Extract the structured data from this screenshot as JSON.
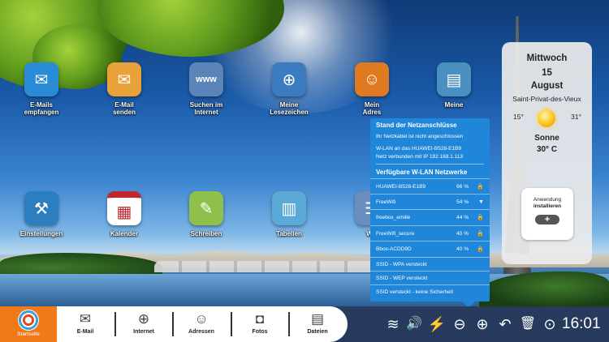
{
  "desktop": {
    "apps": [
      {
        "id": "emails-empfangen",
        "line1": "E-Mails",
        "line2": "empfangen",
        "color": "#2a8bd6",
        "glyph": "✉"
      },
      {
        "id": "email-senden",
        "line1": "E-Mail",
        "line2": "senden",
        "color": "#3aa0e0",
        "glyph": "✉"
      },
      {
        "id": "suchen",
        "line1": "Suchen im",
        "line2": "Internet",
        "color": "#5b84b8",
        "glyph": "www"
      },
      {
        "id": "lesezeichen",
        "line1": "Meine",
        "line2": "Lesezeichen",
        "color": "#3b7bc0",
        "glyph": "⊕"
      },
      {
        "id": "adressen",
        "line1": "Mein",
        "line2": "Adres",
        "color": "#e07a20",
        "glyph": "☺"
      },
      {
        "id": "bilder",
        "line1": "Meine",
        "line2": "",
        "color": "#4a90c0",
        "glyph": "▤"
      },
      {
        "id": "einstellungen",
        "line1": "Einstellungen",
        "line2": "",
        "color": "#2b7fbf",
        "glyph": "⚒"
      },
      {
        "id": "kalender",
        "line1": "Kalender",
        "line2": "",
        "color": "#d8d8d8",
        "glyph": "▦"
      },
      {
        "id": "schreiben",
        "line1": "Schreiben",
        "line2": "",
        "color": "#8fc04a",
        "glyph": "✎"
      },
      {
        "id": "tabellen",
        "line1": "Tabellen",
        "line2": "",
        "color": "#5aa9d6",
        "glyph": "▥"
      },
      {
        "id": "web",
        "line1": "We",
        "line2": "",
        "color": "#6a8fbf",
        "glyph": "☷"
      }
    ]
  },
  "network": {
    "status_title": "Stand der Netzanschlüsse",
    "cable_status": "Ihr Netzkabel ist nicht angeschlossen",
    "wifi_line1": "W-LAN an das HUAWEI-B528-E1B9",
    "wifi_line2": "Netz verbunden mit IP 192.168.1.113",
    "available_title": "Verfügbare W-LAN Netzwerke",
    "networks": [
      {
        "name": "HUAWEI-B528-E1B9",
        "percent": "66 %",
        "icon": "🔒"
      },
      {
        "name": "FreeWifi",
        "percent": "54 %",
        "icon": "▼"
      },
      {
        "name": "freebox_emilie",
        "percent": "44 %",
        "icon": "🔒"
      },
      {
        "name": "FreeWifi_secure",
        "percent": "40 %",
        "icon": "🔒"
      },
      {
        "name": "Bbox-ACDD9D",
        "percent": "40 %",
        "icon": "🔒"
      }
    ],
    "hidden": [
      "SSID - WPA versteckt",
      "SSID - WEP versteckt",
      "SSID versteckt - keine Sicherheit"
    ]
  },
  "weather": {
    "weekday": "Mittwoch",
    "day": "15",
    "month": "August",
    "city": "Saint-Privat-des-Vieux",
    "min": "15°",
    "max": "31°",
    "condition": "Sonne",
    "current": "30° C",
    "install_line1": "Anwendung",
    "install_line2": "installieren",
    "install_plus": "+"
  },
  "taskbar": {
    "start_label": "Startseite",
    "items": [
      {
        "label": "E-Mail",
        "glyph": "✉"
      },
      {
        "label": "Internet",
        "glyph": "⊕"
      },
      {
        "label": "Adressen",
        "glyph": "☺"
      },
      {
        "label": "Fotos",
        "glyph": "◘"
      },
      {
        "label": "Dateien",
        "glyph": "▤"
      }
    ],
    "tray": {
      "wifi": "≋",
      "volume": "🔊",
      "battery": "⚡",
      "zoom_out": "⊖",
      "zoom_in": "⊕",
      "back": "↶",
      "trash": "🗑",
      "help": "⊙"
    },
    "clock": "16:01"
  },
  "colors": {
    "start_orange": "#f07a1a",
    "panel_blue": "#1f86d9",
    "taskbar_dark": "#28385a"
  }
}
